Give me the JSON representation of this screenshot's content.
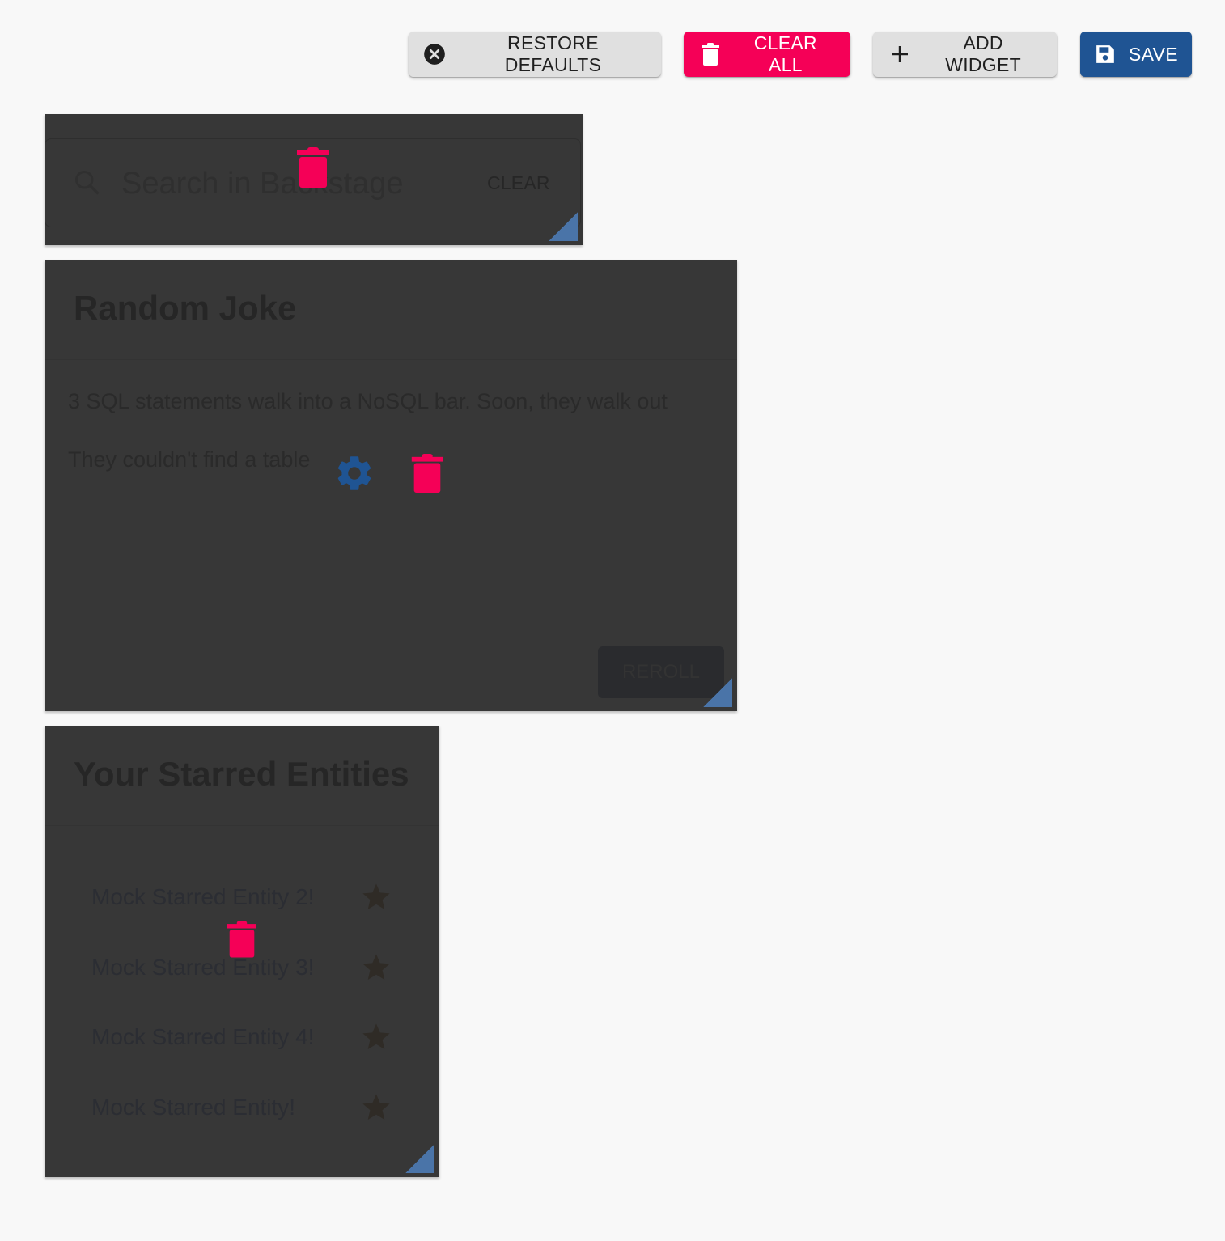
{
  "toolbar": {
    "restore_defaults": "RESTORE DEFAULTS",
    "clear_all": "CLEAR ALL",
    "add_widget": "ADD WIDGET",
    "save": "SAVE"
  },
  "colors": {
    "accent_pink": "#f50057",
    "primary_blue": "#1f5493",
    "widget_bg": "#373737",
    "resize_handle": "#4a74a8"
  },
  "widgets": {
    "search": {
      "placeholder": "Search in Backstage",
      "clear_label": "CLEAR"
    },
    "joke": {
      "title": "Random Joke",
      "setup": "3 SQL statements walk into a NoSQL bar. Soon, they walk out",
      "punchline": "They couldn't find a table",
      "reroll_label": "REROLL"
    },
    "starred": {
      "title": "Your Starred Entities",
      "items": [
        {
          "name": "Mock Starred Entity 2!"
        },
        {
          "name": "Mock Starred Entity 3!"
        },
        {
          "name": "Mock Starred Entity 4!"
        },
        {
          "name": "Mock Starred Entity!"
        }
      ]
    }
  }
}
